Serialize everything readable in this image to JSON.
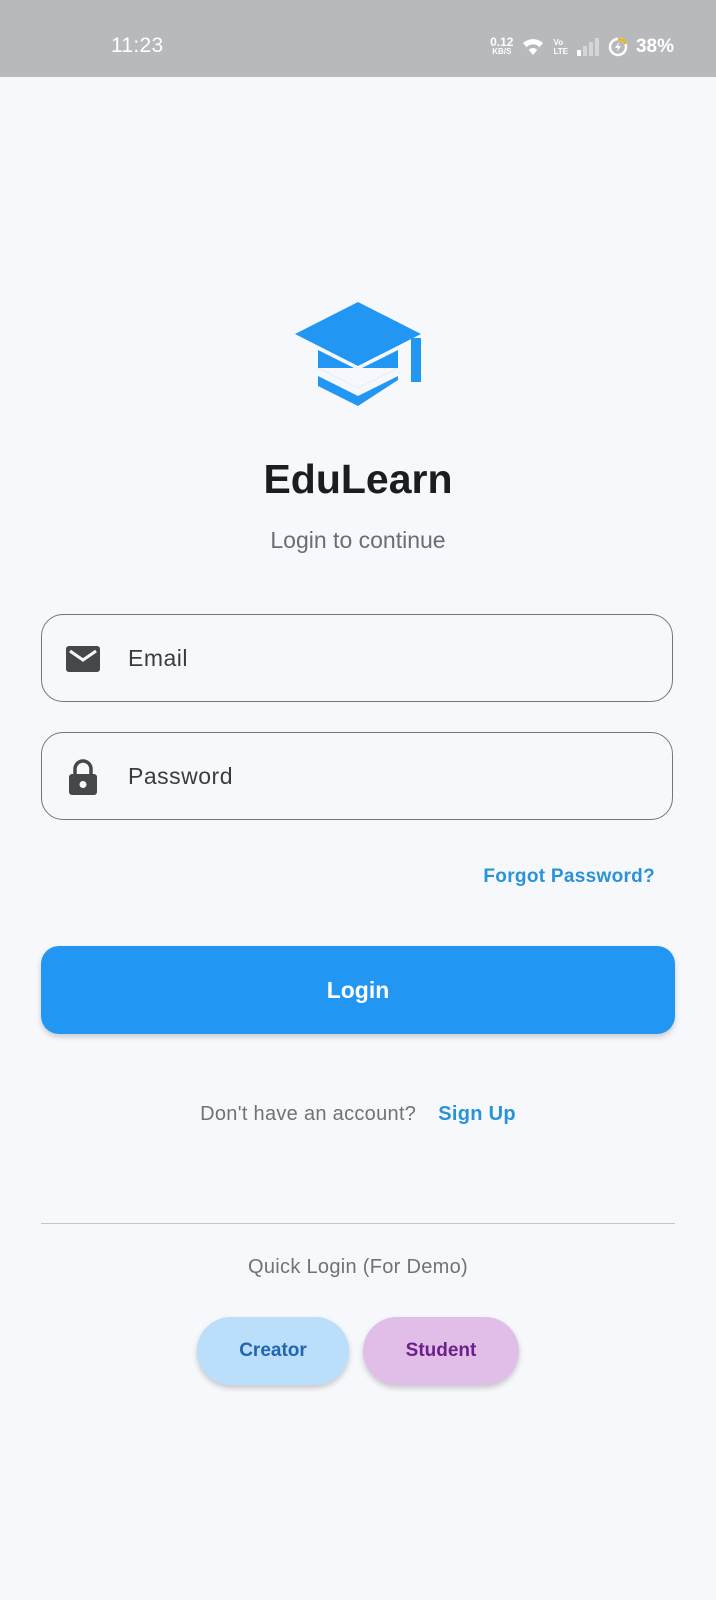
{
  "status_bar": {
    "time": "11:23",
    "net_speed_value": "0.12",
    "net_speed_unit": "KB/S",
    "volte_top": "Vo",
    "volte_bottom": "LTE",
    "battery": "38%"
  },
  "app": {
    "logo_icon": "graduation-cap-icon",
    "title": "EduLearn",
    "subtitle": "Login to continue"
  },
  "form": {
    "email_placeholder": "Email",
    "password_placeholder": "Password",
    "forgot_label": "Forgot Password?",
    "login_label": "Login"
  },
  "signup": {
    "prompt": "Don't have an account?",
    "link": "Sign Up"
  },
  "quick_login": {
    "title": "Quick Login (For Demo)",
    "creator_label": "Creator",
    "student_label": "Student"
  },
  "colors": {
    "primary": "#2196f3",
    "link": "#2a93d8",
    "background": "#f6f8fc",
    "creator_chip": "#bbdefb",
    "student_chip": "#e1bee7"
  }
}
